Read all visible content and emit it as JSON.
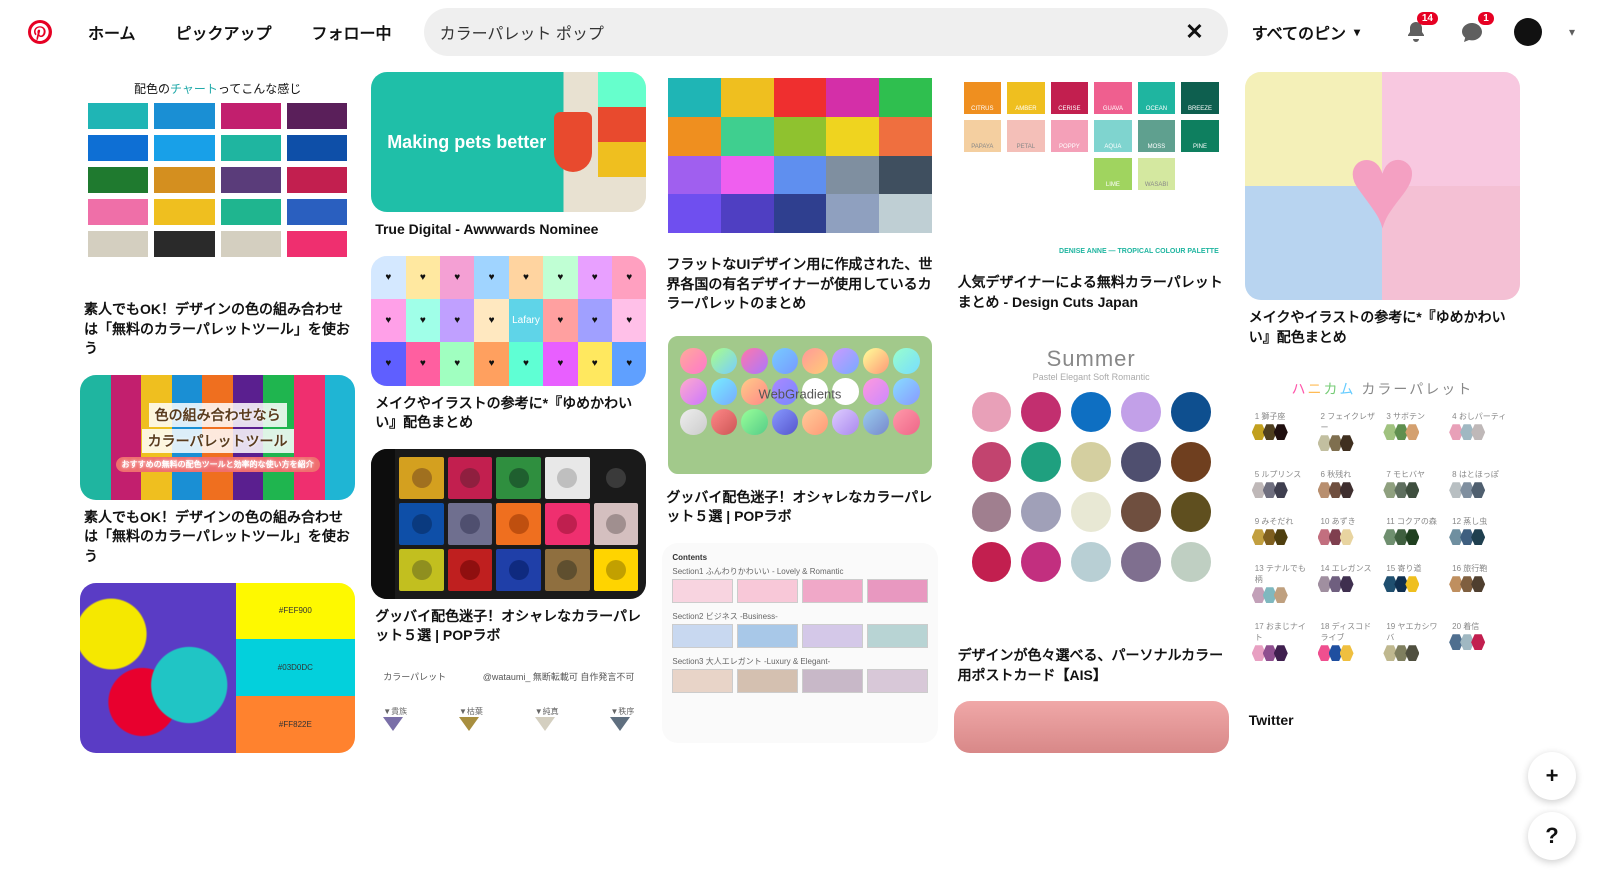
{
  "header": {
    "nav": {
      "home": "ホーム",
      "explore": "ピックアップ",
      "following": "フォロー中"
    },
    "search": {
      "value": "カラーパレット ポップ"
    },
    "filter_label": "すべてのピン",
    "notif_count": "14",
    "msg_count": "1"
  },
  "fab": {
    "plus": "+",
    "help": "?"
  },
  "pins": {
    "p1": "素人でもOK！デザインの色の組み合わせは「無料のカラーパレットツール」を使おう",
    "p2": "素人でもOK！デザインの色の組み合わせは「無料のカラーパレットツール」を使おう",
    "p3": "True Digital - Awwwards Nominee",
    "p4": "メイクやイラストの参考に*『ゆめかわいい』配色まとめ",
    "p5": "グッバイ配色迷子！オシャレなカラーパレット５選 | POPラボ",
    "p6": "フラットなUIデザイン用に作成された、世界各国の有名デザイナーが使用しているカラーパレットのまとめ",
    "p7": "グッバイ配色迷子！オシャレなカラーパレット５選 | POPラボ",
    "p8": "人気デザイナーによる無料カラーパレットまとめ - Design Cuts Japan",
    "p9": "デザインが色々選べる、パーソナルカラー用ポストカード【AIS】",
    "p10": "メイクやイラストの参考に*『ゆめかわいい』配色まとめ",
    "p11": "Twitter"
  },
  "thumb_text": {
    "chart_header": "配色のチャートってこんな感じ",
    "hero": "Making pets better",
    "stripes_l1": "色の組み合わせなら",
    "stripes_l2": "カラーパレットツール",
    "webgrad": "WebGradients",
    "summer_title": "Summer",
    "summer_sub": "Pastel  Elegant  Soft  Romantic",
    "hex_title_a": "ハ",
    "hex_title_b": "ニ",
    "hex_title_c": "カ",
    "hex_title_d": "ム",
    "hex_title_rest": " カラーパレット",
    "paint_c1": "#FEF900",
    "paint_c2": "#03D0DC",
    "paint_c3": "#FF822E",
    "contents_h": "Contents",
    "contents_s1": "Section1  ふんわりかわいい - Lovely & Romantic",
    "contents_s2": "Section2  ビジネス -Business-",
    "contents_s3": "Section3  大人エレガント -Luxury & Elegant-",
    "tri_title": "カラーパレット",
    "tri_credit": "@wataumi_    無断転載可 自作発言不可",
    "denise_footer": "DENISE ANNE — TROPICAL COLOUR PALETTE"
  }
}
